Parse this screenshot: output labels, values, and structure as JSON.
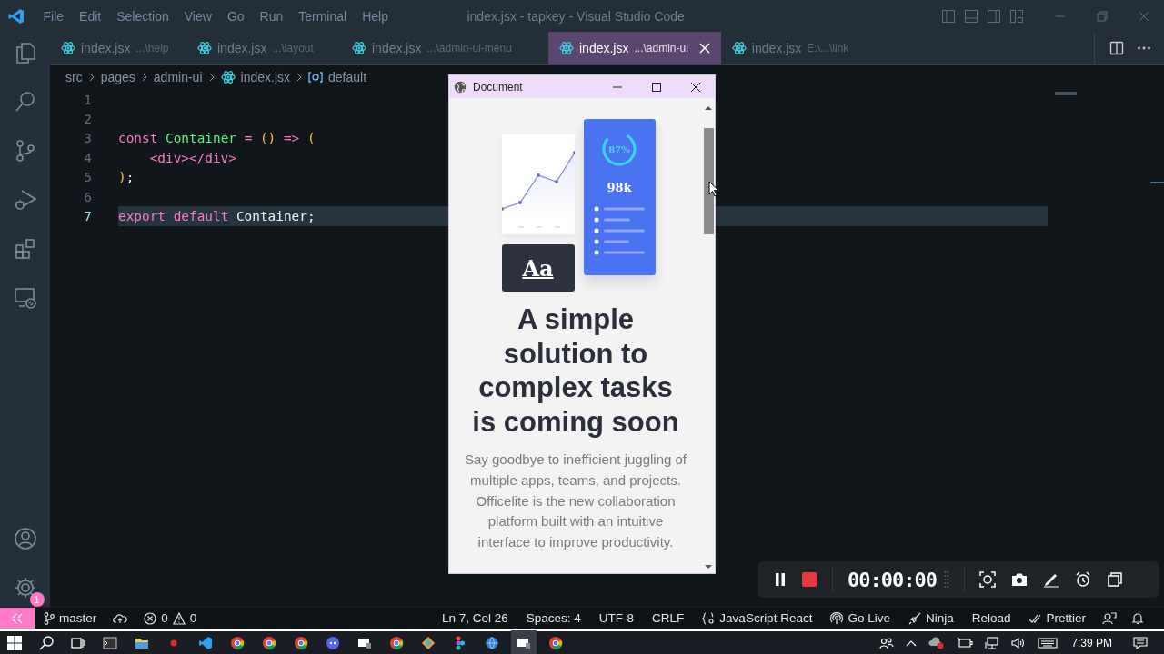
{
  "title_bar": {
    "menu": [
      "File",
      "Edit",
      "Selection",
      "View",
      "Go",
      "Run",
      "Terminal",
      "Help"
    ],
    "title": "index.jsx - tapkey - Visual Studio Code"
  },
  "tabs": [
    {
      "label": "index.jsx",
      "path": "...\\help",
      "selected": false
    },
    {
      "label": "index.jsx",
      "path": "...\\layout",
      "selected": false
    },
    {
      "label": "index.jsx",
      "path": "...\\admin-ui-menu",
      "selected": false
    },
    {
      "label": "index.jsx",
      "path": "...\\admin-ui",
      "selected": true
    },
    {
      "label": "index.jsx",
      "path": "E:\\...\\link",
      "selected": false
    }
  ],
  "breadcrumb": [
    {
      "text": "src",
      "kind": "folder"
    },
    {
      "text": "pages",
      "kind": "folder"
    },
    {
      "text": "admin-ui",
      "kind": "folder"
    },
    {
      "text": "index.jsx",
      "kind": "file"
    },
    {
      "text": "default",
      "kind": "symbol"
    }
  ],
  "editor": {
    "lines": [
      {
        "number": "1",
        "current": false
      },
      {
        "number": "2",
        "current": false
      },
      {
        "number": "3",
        "current": false,
        "tokens": [
          {
            "text": "const ",
            "kind": "keyword"
          },
          {
            "text": "Container ",
            "kind": "name"
          },
          {
            "text": "= ",
            "kind": "operator"
          },
          {
            "text": "() ",
            "kind": "paren"
          },
          {
            "text": "=> ",
            "kind": "operator"
          },
          {
            "text": "(",
            "kind": "paren"
          }
        ]
      },
      {
        "number": "4",
        "current": false,
        "indented": true,
        "tokens": [
          {
            "text": "<div></div>",
            "kind": "keyword"
          }
        ]
      },
      {
        "number": "5",
        "current": false,
        "tokens": [
          {
            "text": ")",
            "kind": "paren"
          },
          {
            "text": ";",
            "kind": "plain"
          }
        ]
      },
      {
        "number": "6",
        "current": false
      },
      {
        "number": "7",
        "current": true,
        "tokens": [
          {
            "text": "export default",
            "kind": "keyword"
          },
          {
            "text": " Container;",
            "kind": "plain"
          }
        ]
      }
    ]
  },
  "activity_bar": {
    "settings_badge": "1"
  },
  "preview_window": {
    "title": "Document",
    "illustration": {
      "ring_label": "87%",
      "level": 0.78,
      "stat": "98k",
      "type_sample": "Aa"
    },
    "heading": "A simple solution to complex tasks is coming soon",
    "text": "Say goodbye to inefficient juggling of multiple apps, teams, and projects. Officelite is the new collaboration platform built with an intuitive interface to improve productivity."
  },
  "recorder": {
    "time": "00:00:00"
  },
  "status_bar": {
    "branch": "master",
    "errors": "0",
    "warnings": "0",
    "right": [
      {
        "text": "Ln 7, Col 26",
        "kind": "plain"
      },
      {
        "text": "Spaces: 4",
        "kind": "plain"
      },
      {
        "text": "UTF-8",
        "kind": "plain"
      },
      {
        "text": "CRLF",
        "kind": "plain"
      },
      {
        "text": "JavaScript React",
        "kind": "braces"
      },
      {
        "text": "Go Live",
        "kind": "broadcast"
      },
      {
        "text": "Ninja",
        "kind": "rocket"
      },
      {
        "text": "Reload",
        "kind": "plain"
      },
      {
        "text": "Prettier",
        "kind": "checks"
      }
    ]
  },
  "taskbar": {
    "time": "7:39 PM"
  }
}
